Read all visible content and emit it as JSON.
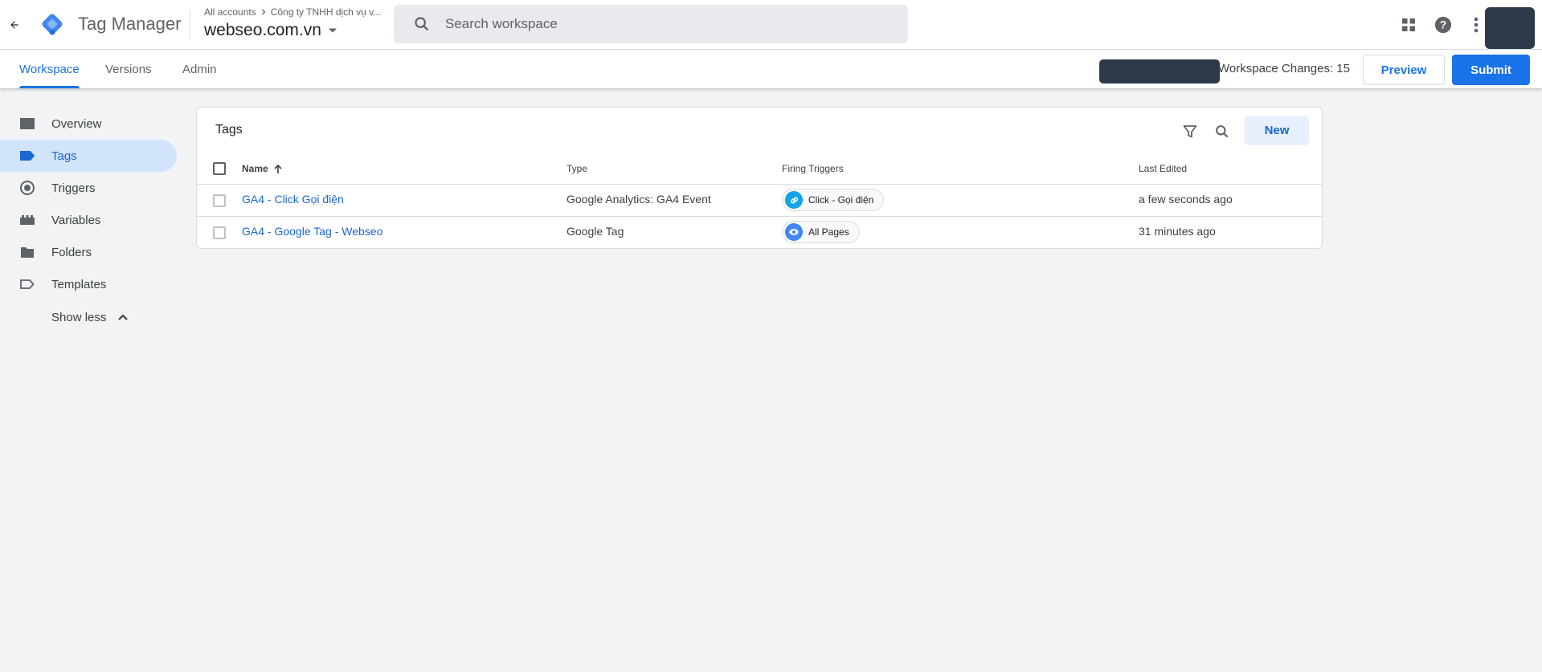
{
  "header": {
    "product_name": "Tag Manager",
    "breadcrumb_root": "All accounts",
    "breadcrumb_account": "Công ty TNHH dịch vụ v...",
    "container_name": "webseo.com.vn",
    "search_placeholder": "Search workspace"
  },
  "subnav": {
    "tabs": [
      {
        "label": "Workspace",
        "active": true
      },
      {
        "label": "Versions",
        "active": false
      },
      {
        "label": "Admin",
        "active": false
      }
    ],
    "workspace_changes": "Workspace Changes: 15",
    "preview_label": "Preview",
    "submit_label": "Submit"
  },
  "sidebar": {
    "items": [
      {
        "label": "Overview",
        "icon": "overview-icon",
        "active": false
      },
      {
        "label": "Tags",
        "icon": "tag-icon",
        "active": true
      },
      {
        "label": "Triggers",
        "icon": "trigger-icon",
        "active": false
      },
      {
        "label": "Variables",
        "icon": "variables-icon",
        "active": false
      },
      {
        "label": "Folders",
        "icon": "folder-icon",
        "active": false
      },
      {
        "label": "Templates",
        "icon": "template-icon",
        "active": false
      }
    ],
    "show_less": "Show less"
  },
  "tags_card": {
    "title": "Tags",
    "new_label": "New",
    "columns": {
      "name": "Name",
      "type": "Type",
      "triggers": "Firing Triggers",
      "edited": "Last Edited"
    },
    "rows": [
      {
        "name": "GA4 - Click Gọi điện",
        "type": "Google Analytics: GA4 Event",
        "trigger": "Click - Gọi điện",
        "trigger_icon": "link-icon",
        "edited": "a few seconds ago"
      },
      {
        "name": "GA4 - Google Tag - Webseo",
        "type": "Google Tag",
        "trigger": "All Pages",
        "trigger_icon": "eye-icon",
        "edited": "31 minutes ago"
      }
    ]
  },
  "colors": {
    "accent": "#1a73e8",
    "active_nav_bg": "#d2e3fc",
    "page_bg": "#f1f3f4"
  }
}
